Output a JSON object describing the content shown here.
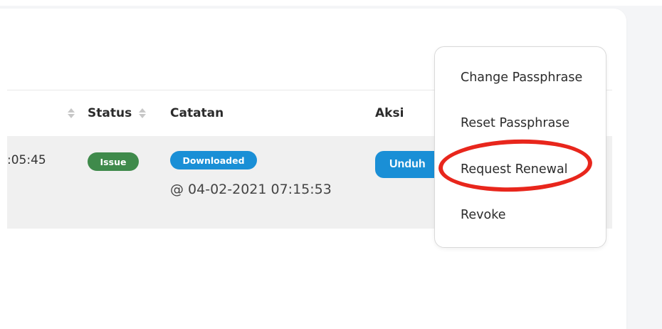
{
  "table": {
    "columns": [
      {
        "label": "",
        "sortable": true
      },
      {
        "label": "Status",
        "sortable": true
      },
      {
        "label": "Catatan",
        "sortable": false
      },
      {
        "label": "Aksi",
        "sortable": false
      }
    ],
    "row": {
      "time_fragment": ":05:45",
      "status_badge": "Issue",
      "note_badge": "Downloaded",
      "note_time": "@ 04-02-2021 07:15:53",
      "action_button": "Unduh"
    }
  },
  "dropdown": {
    "items": [
      {
        "label": "Change Passphrase"
      },
      {
        "label": "Reset Passphrase"
      },
      {
        "label": "Request Renewal",
        "highlighted": true
      },
      {
        "label": "Revoke"
      }
    ]
  },
  "colors": {
    "issue_badge": "#3f8a4b",
    "downloaded_badge": "#1a8fd6",
    "action_button": "#1a8fd6",
    "highlight": "#e8261c"
  }
}
